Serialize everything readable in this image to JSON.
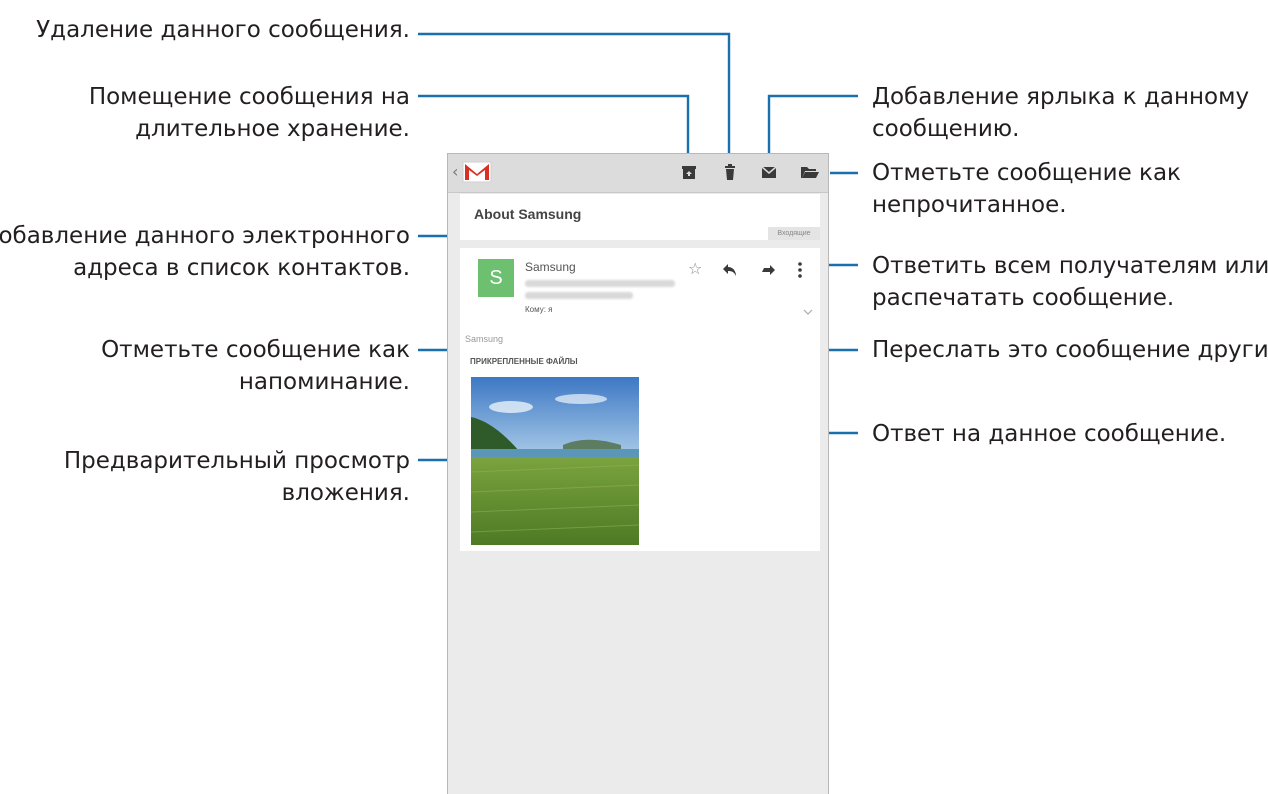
{
  "callouts": {
    "delete": [
      "Удаление данного сообщения."
    ],
    "archive": [
      "Помещение сообщения на",
      "длительное хранение."
    ],
    "add_contact": [
      "Добавление данного электронного",
      "адреса в список контактов."
    ],
    "star": [
      "Отметьте сообщение как",
      "напоминание."
    ],
    "preview": [
      "Предварительный просмотр",
      "вложения."
    ],
    "label": [
      "Добавление ярлыка к данному",
      "сообщению."
    ],
    "mark_unread": [
      "Отметьте сообщение как",
      "непрочитанное."
    ],
    "more": [
      "Ответить всем получателям или",
      "распечатать сообщение."
    ],
    "forward": [
      "Переслать это сообщение другим."
    ],
    "reply": [
      "Ответ на данное сообщение."
    ]
  },
  "email": {
    "subject": "About Samsung",
    "folder": "Входящие",
    "avatar_letter": "S",
    "sender": "Samsung",
    "recipient": "Кому: я",
    "snippet": "Samsung",
    "attachments_header": "ПРИКРЕПЛЕННЫЕ ФАЙЛЫ"
  },
  "icons": {
    "back": "‹",
    "star": "☆"
  },
  "colors": {
    "callout_line": "#1a6fae",
    "avatar": "#6cc070",
    "gmail_red": "#d93025"
  }
}
